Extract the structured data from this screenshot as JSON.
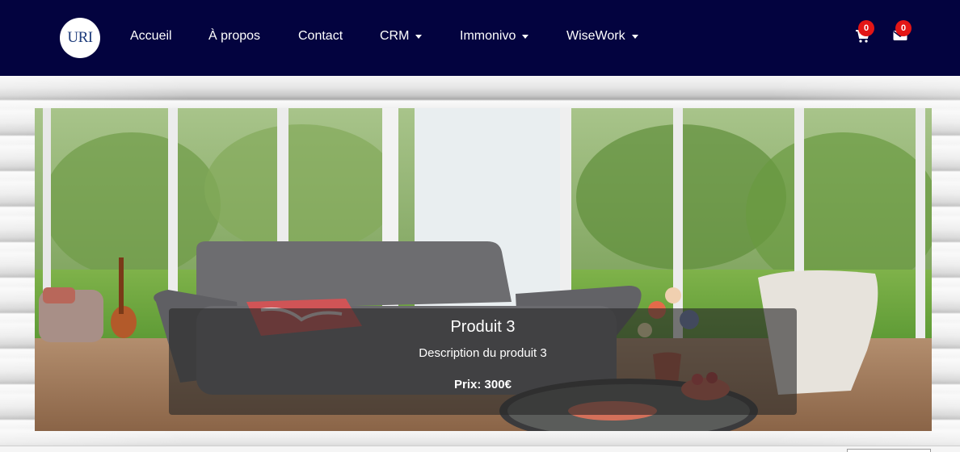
{
  "navbar": {
    "logo_text": "URI",
    "items": [
      {
        "label": "Accueil",
        "dropdown": false
      },
      {
        "label": "À propos",
        "dropdown": false
      },
      {
        "label": "Contact",
        "dropdown": false
      },
      {
        "label": "CRM",
        "dropdown": true
      },
      {
        "label": "Immonivo",
        "dropdown": true
      },
      {
        "label": "WiseWork",
        "dropdown": true
      }
    ],
    "cart": {
      "icon": "cart-icon",
      "count": "0"
    },
    "mail": {
      "icon": "envelope-icon",
      "count": "0"
    },
    "background_color": "#03033f",
    "badge_color": "#e31616"
  },
  "carousel": {
    "slide": {
      "title": "Produit 3",
      "description": "Description du produit 3",
      "price": "Prix: 300€"
    }
  }
}
